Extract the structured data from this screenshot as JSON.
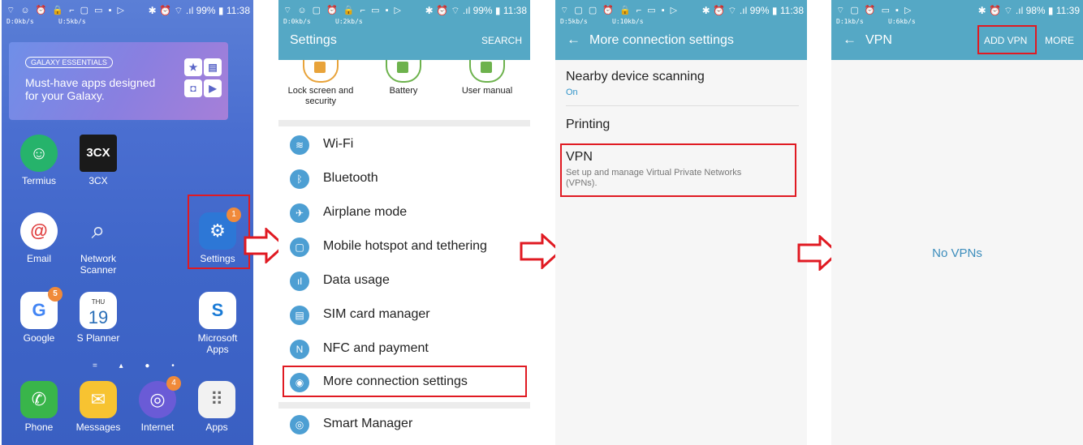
{
  "status": {
    "p1": {
      "icons": "⌔ ☺ ⏰ 🔒 ⌐ ▢ ▭ ▪ ▷",
      "right": "✱ ⏰ ⌔ .ıl 99% ▮ 11:38",
      "down": "D:0kb/s",
      "up": "U:5kb/s"
    },
    "p2": {
      "icons": "⌔ ☺ ▢ ⏰ 🔒 ⌐ ▭ ▪ ▷",
      "right": "✱ ⏰ ⌔ .ıl 99% ▮ 11:38",
      "down": "D:0kb/s",
      "up": "U:2kb/s"
    },
    "p3": {
      "icons": "⌔ ▢ ▢ ⏰ 🔒 ⌐ ▭ ▪ ▷",
      "right": "✱ ⏰ ⌔ .ıl 99% ▮ 11:38",
      "down": "D:5kb/s",
      "up": "U:10kb/s"
    },
    "p4": {
      "icons": "⌔ ▢ ⏰ ▭ ▪ ▷",
      "right": "✱ ⏰ ⌔ .ıl 98% ▮ 11:39",
      "down": "D:1kb/s",
      "up": "U:6kb/s"
    }
  },
  "home": {
    "banner_badge": "GALAXY ESSENTIALS",
    "banner_text": "Must-have apps designed for your Galaxy.",
    "apps": [
      {
        "label": "Termius",
        "glyph": "☺"
      },
      {
        "label": "3CX",
        "glyph": "3CX"
      },
      {
        "label": "Email",
        "glyph": "@"
      },
      {
        "label": "Network Scanner",
        "glyph": "⌕"
      },
      {
        "label": "Settings",
        "glyph": "⚙",
        "badge": "1"
      },
      {
        "label": "Google",
        "glyph": "G",
        "badge": "5"
      },
      {
        "label": "S Planner",
        "glyph": "19",
        "day": "THU"
      },
      {
        "label": "Microsoft Apps",
        "glyph": "S"
      },
      {
        "label": "Phone",
        "glyph": "✆"
      },
      {
        "label": "Messages",
        "glyph": "✉"
      },
      {
        "label": "Internet",
        "glyph": "◎",
        "badge": "4"
      },
      {
        "label": "Apps",
        "glyph": "⠿"
      }
    ]
  },
  "settings": {
    "title": "Settings",
    "action": "SEARCH",
    "tiles": [
      "Lock screen and security",
      "Battery",
      "User manual"
    ],
    "items": [
      {
        "label": "Wi-Fi",
        "glyph": "≋"
      },
      {
        "label": "Bluetooth",
        "glyph": "ᛒ"
      },
      {
        "label": "Airplane mode",
        "glyph": "✈"
      },
      {
        "label": "Mobile hotspot and tethering",
        "glyph": "▢"
      },
      {
        "label": "Data usage",
        "glyph": "ıl"
      },
      {
        "label": "SIM card manager",
        "glyph": "▤"
      },
      {
        "label": "NFC and payment",
        "glyph": "N"
      },
      {
        "label": "More connection settings",
        "glyph": "◉"
      },
      {
        "label": "Smart Manager",
        "glyph": "◎"
      }
    ]
  },
  "more": {
    "title": "More connection settings",
    "nearby_title": "Nearby device scanning",
    "nearby_sub": "On",
    "printing": "Printing",
    "vpn_title": "VPN",
    "vpn_sub": "Set up and manage Virtual Private Networks (VPNs)."
  },
  "vpn": {
    "title": "VPN",
    "add": "ADD VPN",
    "more": "MORE",
    "empty": "No VPNs"
  },
  "colors": {
    "accent": "#55a8c5",
    "highlight": "#e01a22"
  }
}
